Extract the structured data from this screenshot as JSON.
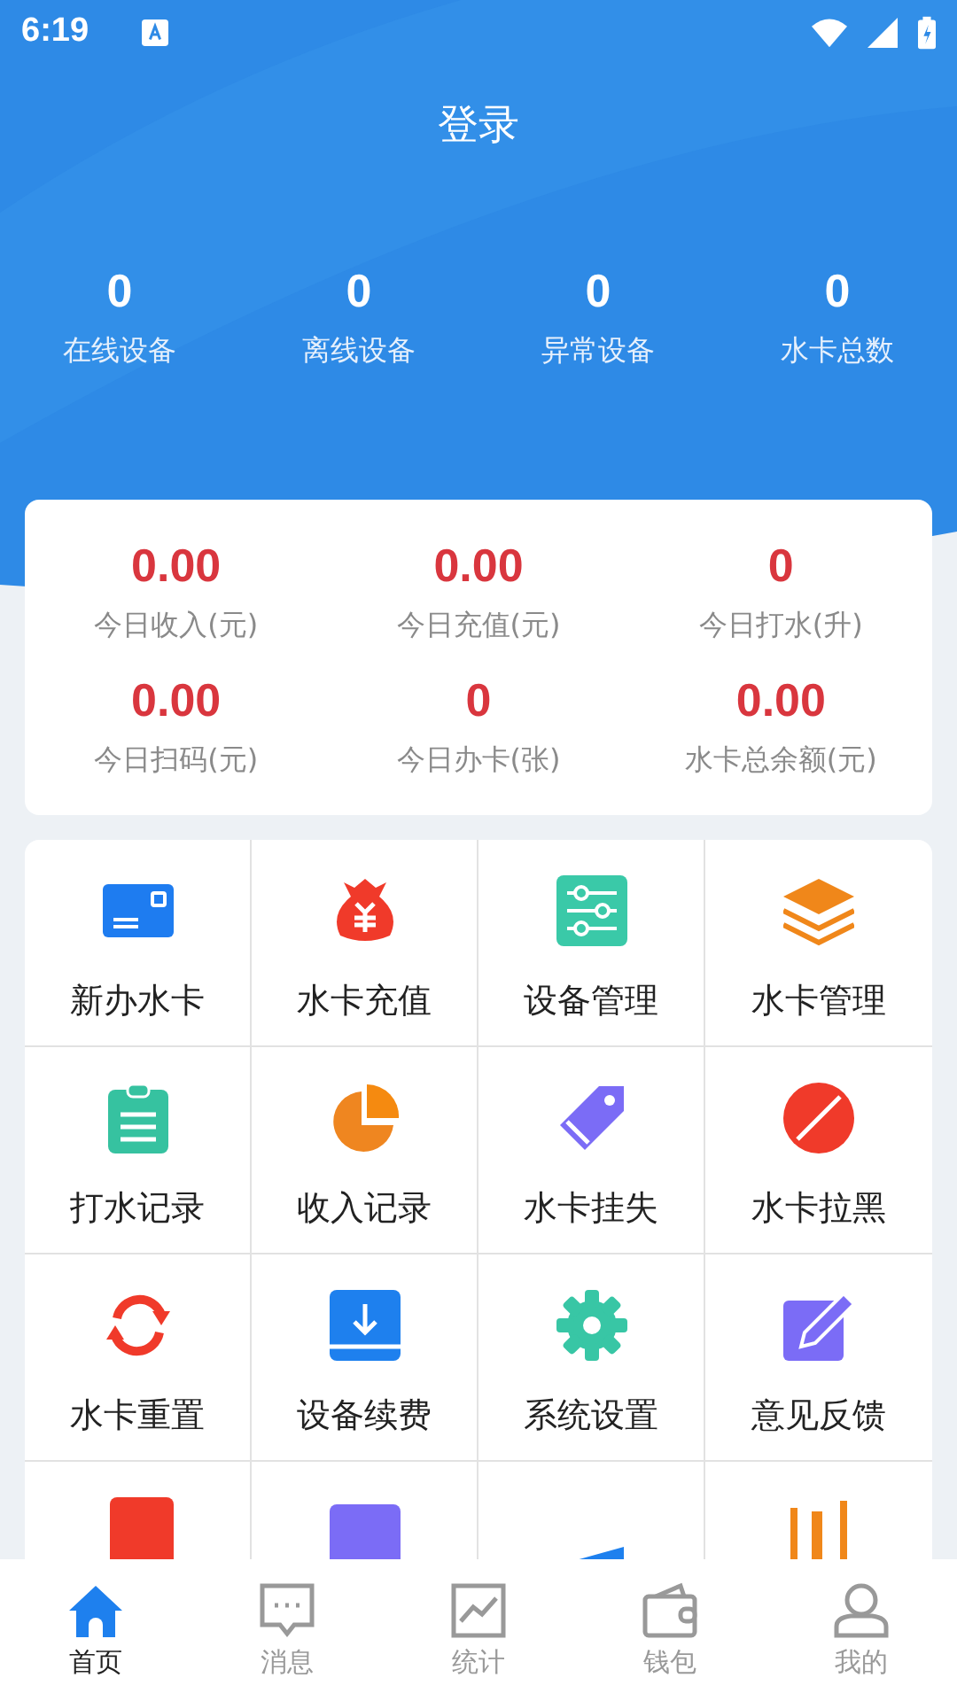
{
  "status_bar": {
    "time": "6:19"
  },
  "header": {
    "title": "登录"
  },
  "summary": [
    {
      "value": "0",
      "label": "在线设备"
    },
    {
      "value": "0",
      "label": "离线设备"
    },
    {
      "value": "0",
      "label": "异常设备"
    },
    {
      "value": "0",
      "label": "水卡总数"
    }
  ],
  "today": [
    {
      "value": "0.00",
      "label": "今日收入(元)"
    },
    {
      "value": "0.00",
      "label": "今日充值(元)"
    },
    {
      "value": "0",
      "label": "今日打水(升)"
    },
    {
      "value": "0.00",
      "label": "今日扫码(元)"
    },
    {
      "value": "0",
      "label": "今日办卡(张)"
    },
    {
      "value": "0.00",
      "label": "水卡总余额(元)"
    }
  ],
  "functions": [
    {
      "label": "新办水卡"
    },
    {
      "label": "水卡充值"
    },
    {
      "label": "设备管理"
    },
    {
      "label": "水卡管理"
    },
    {
      "label": "打水记录"
    },
    {
      "label": "收入记录"
    },
    {
      "label": "水卡挂失"
    },
    {
      "label": "水卡拉黑"
    },
    {
      "label": "水卡重置"
    },
    {
      "label": "设备续费"
    },
    {
      "label": "系统设置"
    },
    {
      "label": "意见反馈"
    }
  ],
  "tab_bar": [
    {
      "label": "首页",
      "selected": true
    },
    {
      "label": "消息",
      "selected": false
    },
    {
      "label": "统计",
      "selected": false
    },
    {
      "label": "钱包",
      "selected": false
    },
    {
      "label": "我的",
      "selected": false
    }
  ]
}
